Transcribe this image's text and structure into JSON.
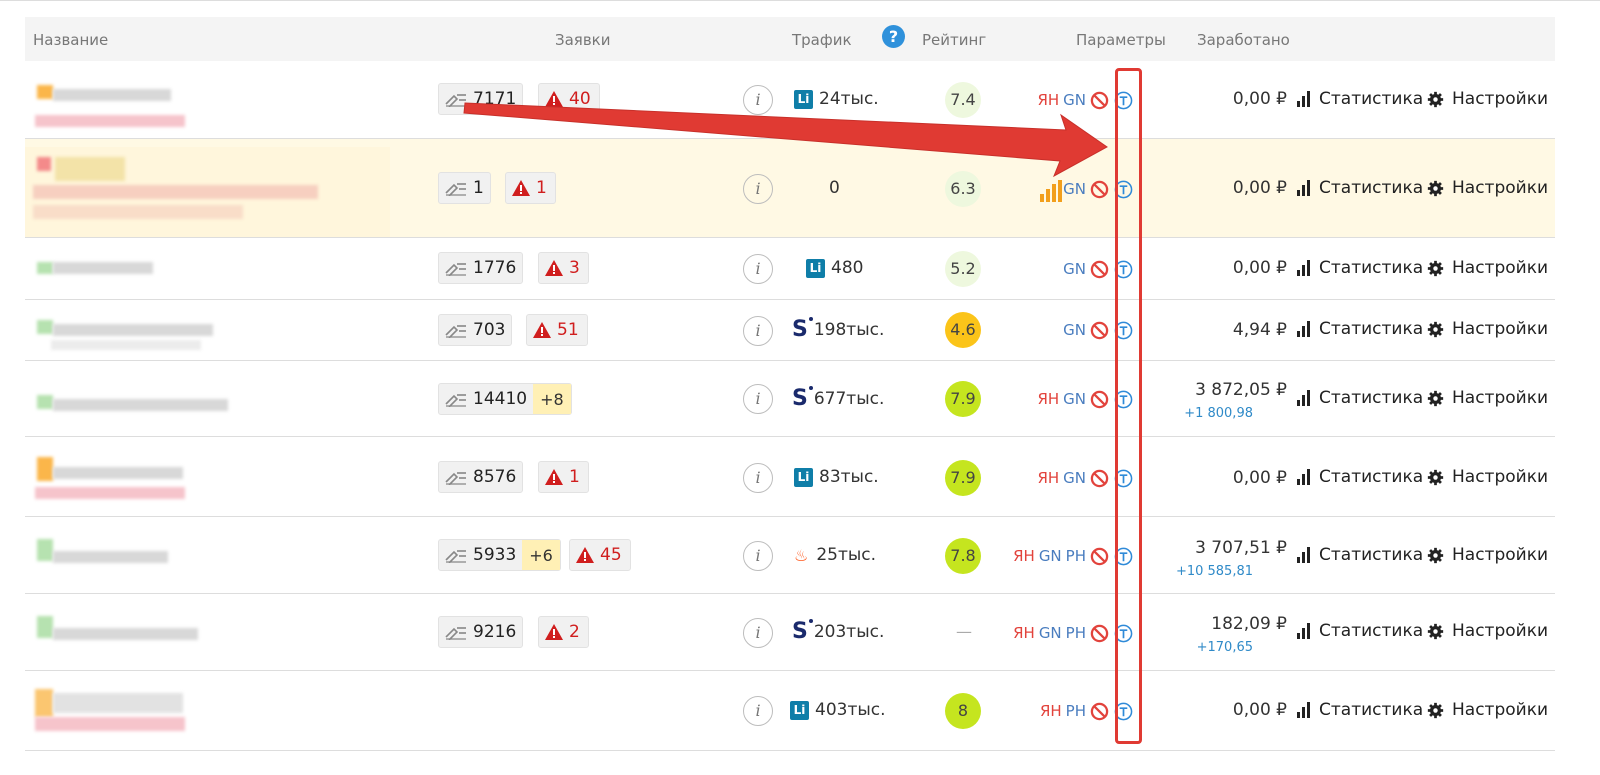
{
  "header": {
    "name": "Название",
    "requests": "Заявки",
    "traffic": "Трафик",
    "help": "?",
    "rating": "Рейтинг",
    "params": "Параметры",
    "earned": "Заработано"
  },
  "info_label": "i",
  "stats_label": "Статистика",
  "settings_label": "Настройки",
  "rows": [
    {
      "req": "7171",
      "plus": "",
      "warn": "40",
      "traffic": "24тыс.",
      "tsrc": "li",
      "rating": "7.4",
      "rcolor": "#eef8de",
      "yn": "ЯН",
      "gn": "GN",
      "rh": "",
      "amount": "0,00 ₽",
      "delta": ""
    },
    {
      "req": "1",
      "plus": "",
      "warn": "1",
      "traffic": "0",
      "tsrc": "",
      "rating": "6.3",
      "rcolor": "#eef8de",
      "yn": "",
      "gn": "GN",
      "rh": "",
      "amount": "0,00 ₽",
      "delta": ""
    },
    {
      "req": "1776",
      "plus": "",
      "warn": "3",
      "traffic": "480",
      "tsrc": "li",
      "rating": "5.2",
      "rcolor": "#eef8de",
      "yn": "",
      "gn": "GN",
      "rh": "",
      "amount": "0,00 ₽",
      "delta": ""
    },
    {
      "req": "703",
      "plus": "",
      "warn": "51",
      "traffic": "198тыс.",
      "tsrc": "s",
      "rating": "4.6",
      "rcolor": "#fbc419",
      "yn": "",
      "gn": "GN",
      "rh": "",
      "amount": "4,94 ₽",
      "delta": ""
    },
    {
      "req": "14410",
      "plus": "+8",
      "warn": "",
      "traffic": "677тыс.",
      "tsrc": "s",
      "rating": "7.9",
      "rcolor": "#c5e51f",
      "yn": "ЯН",
      "gn": "GN",
      "rh": "",
      "amount": "3 872,05 ₽",
      "delta": "+1 800,98"
    },
    {
      "req": "8576",
      "plus": "",
      "warn": "1",
      "traffic": "83тыс.",
      "tsrc": "li",
      "rating": "7.9",
      "rcolor": "#c5e51f",
      "yn": "ЯН",
      "gn": "GN",
      "rh": "",
      "amount": "0,00 ₽",
      "delta": ""
    },
    {
      "req": "5933",
      "plus": "+6",
      "warn": "45",
      "traffic": "25тыс.",
      "tsrc": "fire",
      "rating": "7.8",
      "rcolor": "#c5e51f",
      "yn": "ЯН",
      "gn": "GN",
      "rh": "PH",
      "amount": "3 707,51 ₽",
      "delta": "+10 585,81"
    },
    {
      "req": "9216",
      "plus": "",
      "warn": "2",
      "traffic": "203тыс.",
      "tsrc": "s",
      "rating": "—",
      "rcolor": "",
      "yn": "ЯН",
      "gn": "GN",
      "rh": "PH",
      "amount": "182,09 ₽",
      "delta": "+170,65"
    },
    {
      "req": "",
      "plus": "",
      "warn": "",
      "traffic": "403тыс.",
      "tsrc": "li",
      "rating": "8",
      "rcolor": "#c5e51f",
      "yn": "ЯН",
      "gn": "",
      "rh": "PH",
      "amount": "0,00 ₽",
      "delta": ""
    }
  ],
  "colors": {
    "annotation": "#e03a33",
    "link": "#2f8ac8",
    "highlight_row": "#fff9e4"
  }
}
